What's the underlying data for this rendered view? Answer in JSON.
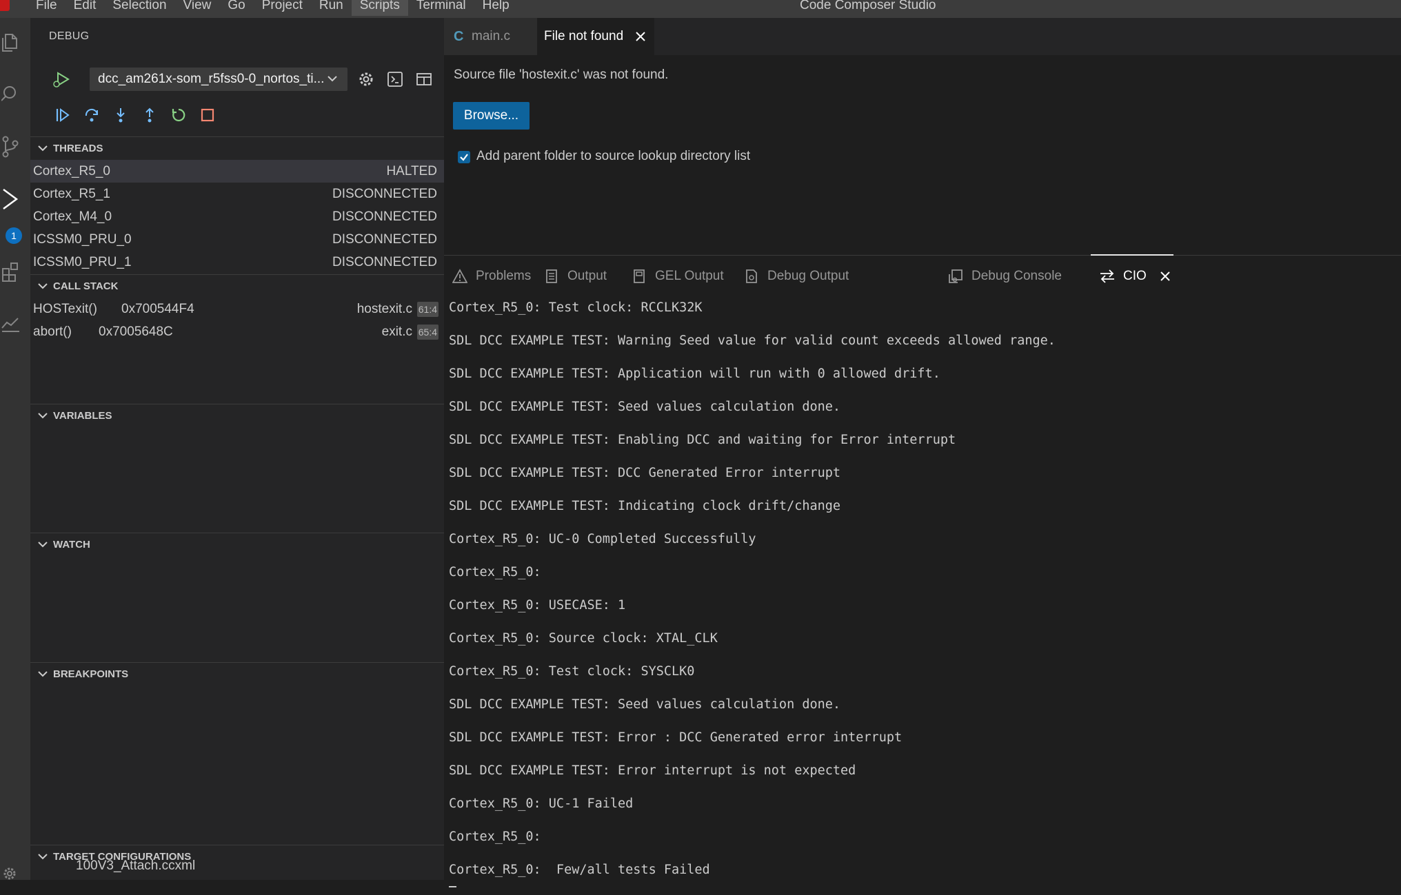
{
  "window": {
    "title": "Code Composer Studio",
    "menu": [
      "File",
      "Edit",
      "Selection",
      "View",
      "Go",
      "Project",
      "Run",
      "Scripts",
      "Terminal",
      "Help"
    ],
    "active_menu": "Scripts"
  },
  "activity_bar": {
    "icons": [
      "explorer-icon",
      "search-icon",
      "source-control-icon",
      "run-debug-icon",
      "extensions-icon",
      "analysis-icon",
      "settings-gear-icon"
    ],
    "debug_badge": "1"
  },
  "sidebar": {
    "header": "DEBUG",
    "launch_config": "dcc_am261x-som_r5fss0-0_nortos_ti...",
    "toolbar_icons": [
      "continue-icon",
      "step-over-icon",
      "step-into-icon",
      "step-out-icon",
      "restart-icon",
      "stop-icon"
    ],
    "threads": {
      "title": "THREADS",
      "items": [
        {
          "name": "Cortex_R5_0",
          "state": "HALTED"
        },
        {
          "name": "Cortex_R5_1",
          "state": "DISCONNECTED"
        },
        {
          "name": "Cortex_M4_0",
          "state": "DISCONNECTED"
        },
        {
          "name": "ICSSM0_PRU_0",
          "state": "DISCONNECTED"
        },
        {
          "name": "ICSSM0_PRU_1",
          "state": "DISCONNECTED"
        }
      ]
    },
    "call_stack": {
      "title": "CALL STACK",
      "items": [
        {
          "fn": "HOSTexit()",
          "addr": "0x700544F4",
          "file": "hostexit.c",
          "line": "61:4"
        },
        {
          "fn": "abort()",
          "addr": "0x7005648C",
          "file": "exit.c",
          "line": "65:4"
        }
      ]
    },
    "variables": {
      "title": "VARIABLES"
    },
    "watch": {
      "title": "WATCH"
    },
    "breakpoints": {
      "title": "BREAKPOINTS"
    },
    "target_configs": {
      "title": "TARGET CONFIGURATIONS",
      "items": [
        "100V3_Attach.ccxml"
      ]
    }
  },
  "editor": {
    "tabs": [
      {
        "label": "main.c",
        "icon": "C"
      },
      {
        "label": "File not found"
      }
    ],
    "message": "Source file 'hostexit.c' was not found.",
    "browse_label": "Browse...",
    "checkbox_label": "Add parent folder to source lookup directory list",
    "checkbox_checked": true
  },
  "panel": {
    "tabs": [
      "Problems",
      "Output",
      "GEL Output",
      "Debug Output",
      "Debug Console",
      "CIO"
    ],
    "active_tab": "CIO",
    "console_lines": [
      "Cortex_R5_0: Test clock: RCCLK32K",
      "SDL DCC EXAMPLE TEST: Warning Seed value for valid count exceeds allowed range.",
      "SDL DCC EXAMPLE TEST: Application will run with 0 allowed drift.",
      "SDL DCC EXAMPLE TEST: Seed values calculation done.",
      "SDL DCC EXAMPLE TEST: Enabling DCC and waiting for Error interrupt",
      "SDL DCC EXAMPLE TEST: DCC Generated Error interrupt",
      "SDL DCC EXAMPLE TEST: Indicating clock drift/change",
      "Cortex_R5_0: UC-0 Completed Successfully",
      "Cortex_R5_0:",
      "Cortex_R5_0: USECASE: 1",
      "Cortex_R5_0: Source clock: XTAL_CLK",
      "Cortex_R5_0: Test clock: SYSCLK0",
      "SDL DCC EXAMPLE TEST: Seed values calculation done.",
      "SDL DCC EXAMPLE TEST: Error : DCC Generated error interrupt",
      "SDL DCC EXAMPLE TEST: Error interrupt is not expected",
      "Cortex_R5_0: UC-1 Failed",
      "Cortex_R5_0:",
      "Cortex_R5_0:  Few/all tests Failed"
    ]
  },
  "colors": {
    "accent_blue": "#0e639c",
    "debug_blue": "#75beff",
    "restart_green": "#89d185",
    "stop_red": "#f48771"
  }
}
